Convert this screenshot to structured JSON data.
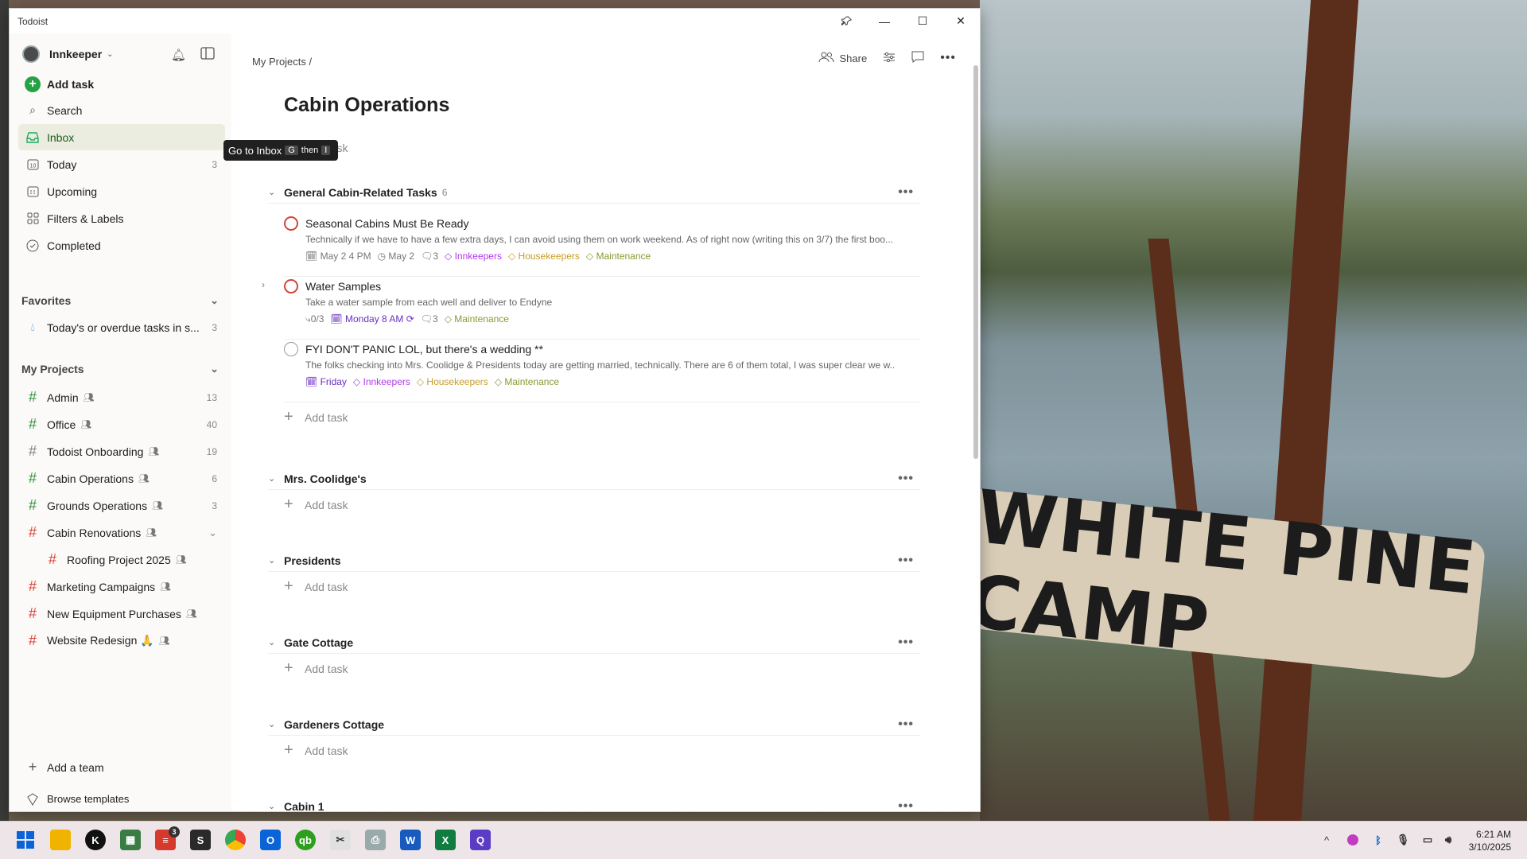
{
  "window": {
    "title": "Todoist"
  },
  "wallpaper": {
    "sign_text": "WHITE PINE CAMP"
  },
  "sidebar": {
    "user_name": "Innkeeper",
    "add_task": "Add task",
    "nav": [
      {
        "label": "Search",
        "count": ""
      },
      {
        "label": "Inbox",
        "count": ""
      },
      {
        "label": "Today",
        "count": "3"
      },
      {
        "label": "Upcoming",
        "count": ""
      },
      {
        "label": "Filters & Labels",
        "count": ""
      },
      {
        "label": "Completed",
        "count": ""
      }
    ],
    "favorites_title": "Favorites",
    "favorites": [
      {
        "label": "Today's or overdue tasks in s...",
        "count": "3"
      }
    ],
    "projects_title": "My Projects",
    "projects": [
      {
        "label": "Admin",
        "count": "13",
        "color": "#299438"
      },
      {
        "label": "Office",
        "count": "40",
        "color": "#299438"
      },
      {
        "label": "Todoist Onboarding",
        "count": "19",
        "color": "#808080"
      },
      {
        "label": "Cabin Operations",
        "count": "6",
        "color": "#299438"
      },
      {
        "label": "Grounds Operations",
        "count": "3",
        "color": "#299438"
      },
      {
        "label": "Cabin Renovations",
        "count": "",
        "color": "#db4035"
      },
      {
        "label": "Roofing Project 2025",
        "count": "",
        "color": "#db4035"
      },
      {
        "label": "Marketing Campaigns",
        "count": "",
        "color": "#db4035"
      },
      {
        "label": "New Equipment Purchases",
        "count": "",
        "color": "#db4035"
      },
      {
        "label": "Website Redesign 🙏",
        "count": "",
        "color": "#db4035"
      }
    ],
    "add_team": "Add a team",
    "browse_templates": "Browse templates"
  },
  "tooltip": {
    "text": "Go to Inbox",
    "key1": "G",
    "then": "then",
    "key2": "I"
  },
  "main": {
    "breadcrumb": "My Projects /",
    "share": "Share",
    "title": "Cabin Operations",
    "add_task": "Add task",
    "sections": [
      {
        "name": "General Cabin-Related Tasks",
        "count": "6"
      },
      {
        "name": "Mrs. Coolidge's",
        "count": ""
      },
      {
        "name": "Presidents",
        "count": ""
      },
      {
        "name": "Gate Cottage",
        "count": ""
      },
      {
        "name": "Gardeners Cottage",
        "count": ""
      },
      {
        "name": "Cabin 1",
        "count": ""
      }
    ],
    "tasks": [
      {
        "name": "Seasonal Cabins Must Be Ready",
        "desc": "Technically if we have to have a few extra days, I can avoid using them on work weekend. As of right now (writing this on 3/7) the first boo...",
        "meta": {
          "date": "May 2 4 PM",
          "deadline": "May 2",
          "comments": "3",
          "l1": "Innkeepers",
          "l2": "Housekeepers",
          "l3": "Maintenance"
        }
      },
      {
        "name": "Water Samples",
        "desc": "Take a water sample from each well and deliver to Endyne",
        "meta": {
          "subtasks": "0/3",
          "date": "Monday 8 AM",
          "comments": "3",
          "l3": "Maintenance"
        }
      },
      {
        "name": "FYI DON'T PANIC LOL, but there's a wedding **",
        "desc": "The folks checking into Mrs. Coolidge & Presidents today are getting married, technically. There are 6 of them total, I was super clear we w...",
        "meta": {
          "date": "Friday",
          "l1": "Innkeepers",
          "l2": "Housekeepers",
          "l3": "Maintenance"
        }
      }
    ]
  },
  "taskbar": {
    "todoist_badge": "3",
    "clock_time": "6:21 AM",
    "clock_date": "3/10/2025"
  },
  "colors": {
    "accent": "#d1453b",
    "active_nav": "#ebede0"
  }
}
